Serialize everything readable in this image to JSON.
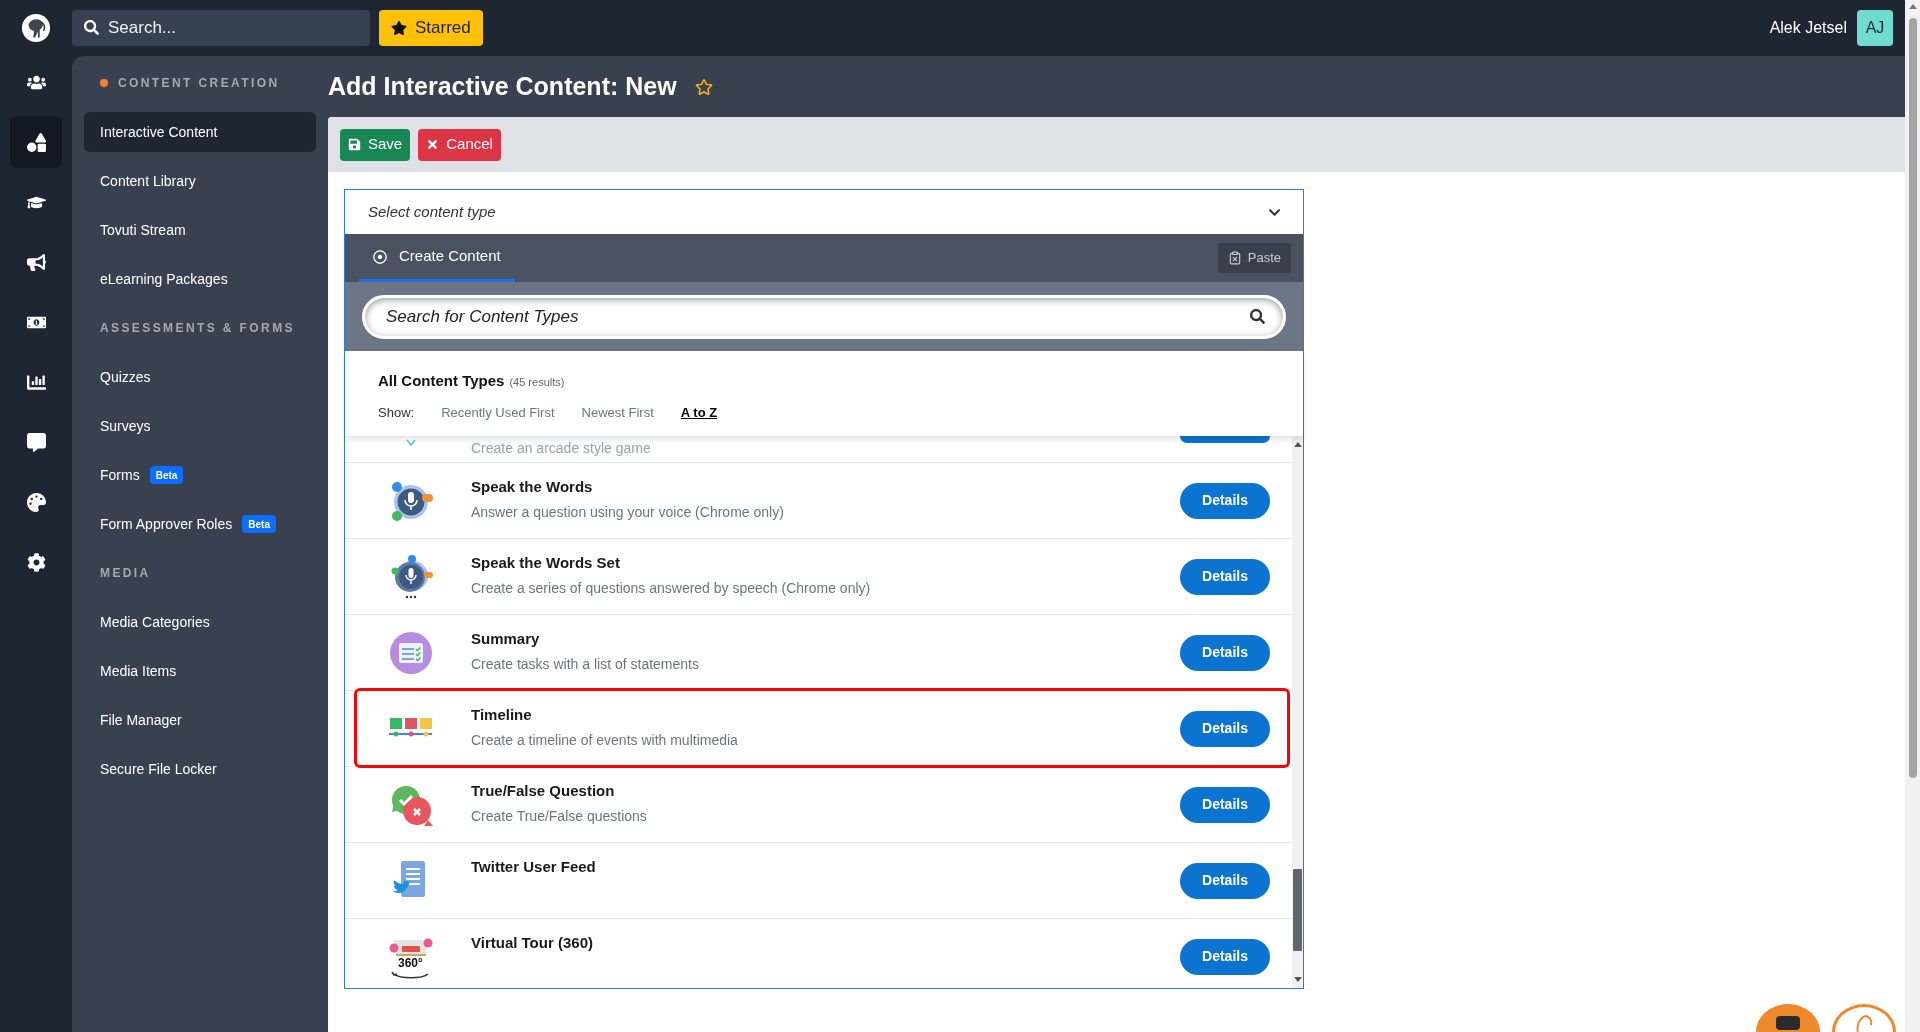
{
  "topbar": {
    "search": {
      "placeholder": "Search..."
    },
    "starred_button": "Starred",
    "user": {
      "name": "Alek Jetsel",
      "initials": "AJ"
    }
  },
  "rail": [
    {
      "selected": false
    },
    {
      "selected": true
    },
    {
      "selected": false
    },
    {
      "selected": false
    },
    {
      "selected": false
    },
    {
      "selected": false
    },
    {
      "selected": false
    },
    {
      "selected": false
    },
    {
      "selected": false
    }
  ],
  "sidebar": {
    "sections": [
      {
        "title": "CONTENT CREATION",
        "active": true,
        "items": [
          {
            "label": "Interactive Content",
            "selected": true
          },
          {
            "label": "Content Library",
            "selected": false
          },
          {
            "label": "Tovuti Stream",
            "selected": false
          },
          {
            "label": "eLearning Packages",
            "selected": false
          }
        ]
      },
      {
        "title": "ASSESSMENTS & FORMS",
        "active": false,
        "items": [
          {
            "label": "Quizzes",
            "selected": false
          },
          {
            "label": "Surveys",
            "selected": false
          },
          {
            "label": "Forms",
            "selected": false,
            "badge": "Beta"
          },
          {
            "label": "Form Approver Roles",
            "selected": false,
            "badge": "Beta"
          }
        ]
      },
      {
        "title": "MEDIA",
        "active": false,
        "items": [
          {
            "label": "Media Categories",
            "selected": false
          },
          {
            "label": "Media Items",
            "selected": false
          },
          {
            "label": "File Manager",
            "selected": false
          },
          {
            "label": "Secure File Locker",
            "selected": false
          }
        ]
      }
    ]
  },
  "page": {
    "title": "Add Interactive Content: New",
    "starred": false
  },
  "toolbar": {
    "buttons": [
      {
        "kind": "save",
        "label": "Save"
      },
      {
        "kind": "cancel",
        "label": "Cancel"
      }
    ]
  },
  "content_picker": {
    "select": {
      "label": "Select content type"
    },
    "tabs": [
      {
        "label": "Create Content",
        "selected": true
      }
    ],
    "paste_button": "Paste",
    "search": {
      "placeholder": "Search for Content Types"
    },
    "heading": "All Content Types",
    "result_count": "(45 results)",
    "sort": {
      "label": "Show:",
      "options": [
        {
          "label": "Recently Used First",
          "selected": false
        },
        {
          "label": "Newest First",
          "selected": false
        },
        {
          "label": "A to Z",
          "selected": true
        }
      ]
    },
    "items": [
      {
        "kind": "clipped",
        "description": "Create an arcade style game"
      },
      {
        "kind": "item",
        "title": "Speak the Words",
        "description": "Answer a question using your voice (Chrome only)",
        "button": "Details",
        "highlighted": false
      },
      {
        "kind": "item",
        "title": "Speak the Words Set",
        "description": "Create a series of questions answered by speech (Chrome only)",
        "button": "Details",
        "highlighted": false
      },
      {
        "kind": "item",
        "title": "Summary",
        "description": "Create tasks with a list of statements",
        "button": "Details",
        "highlighted": false
      },
      {
        "kind": "item",
        "title": "Timeline",
        "description": "Create a timeline of events with multimedia",
        "button": "Details",
        "highlighted": true
      },
      {
        "kind": "item",
        "title": "True/False Question",
        "description": "Create True/False questions",
        "button": "Details",
        "highlighted": false
      },
      {
        "kind": "item",
        "title": "Twitter User Feed",
        "button": "Details",
        "highlighted": false
      },
      {
        "kind": "item",
        "title": "Virtual Tour (360)",
        "icon_label": "360°",
        "button": "Details",
        "highlighted": false
      }
    ]
  }
}
